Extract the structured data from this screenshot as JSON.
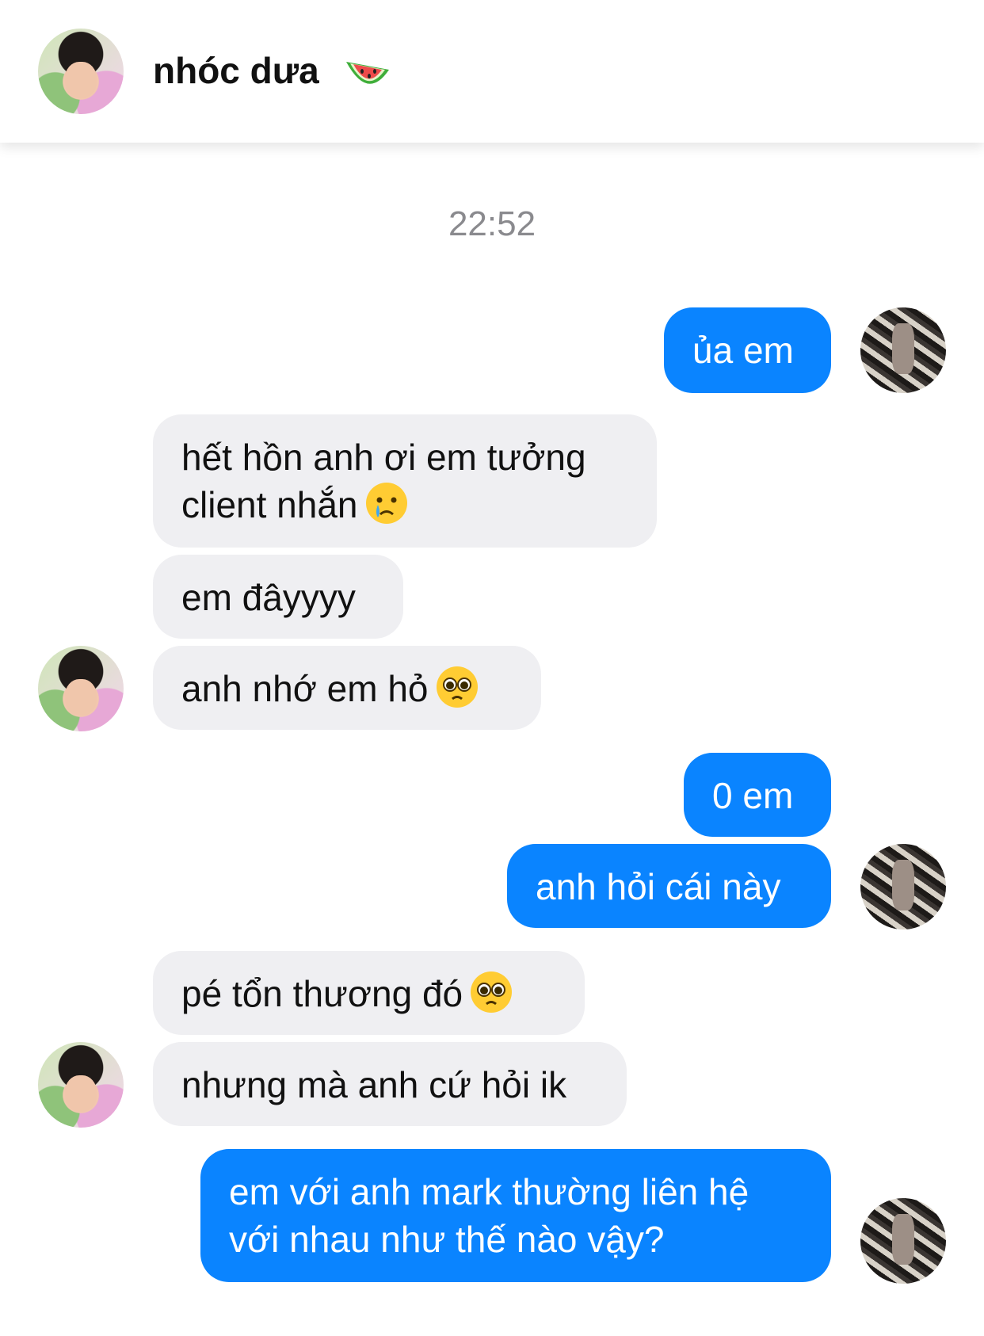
{
  "header": {
    "contact_name": "nhóc dưa",
    "contact_emoji_icon": "watermelon-icon"
  },
  "conversation": {
    "timestamp": "22:52",
    "messages": [
      {
        "from": "me",
        "text": "ủa em"
      },
      {
        "from": "contact",
        "line1": "hết hồn anh ơi em tưởng",
        "line2": "client nhắn",
        "emoji_icon": "crying-face-icon"
      },
      {
        "from": "contact",
        "text": "em đâyyyy"
      },
      {
        "from": "contact",
        "text": "anh nhớ em hỏ",
        "emoji_icon": "pleading-face-icon"
      },
      {
        "from": "me",
        "text": "0 em"
      },
      {
        "from": "me",
        "text": "anh hỏi cái này"
      },
      {
        "from": "contact",
        "text": "pé tổn thương đó",
        "emoji_icon": "pleading-face-icon"
      },
      {
        "from": "contact",
        "text": "nhưng mà anh cứ hỏi ik"
      },
      {
        "from": "me",
        "line1": "em với anh mark thường liên hệ",
        "line2": "với nhau như thế nào vậy?"
      }
    ]
  },
  "colors": {
    "outgoing_bubble": "#0a84ff",
    "incoming_bubble": "#efeff2",
    "timestamp": "#8a8a8e"
  }
}
